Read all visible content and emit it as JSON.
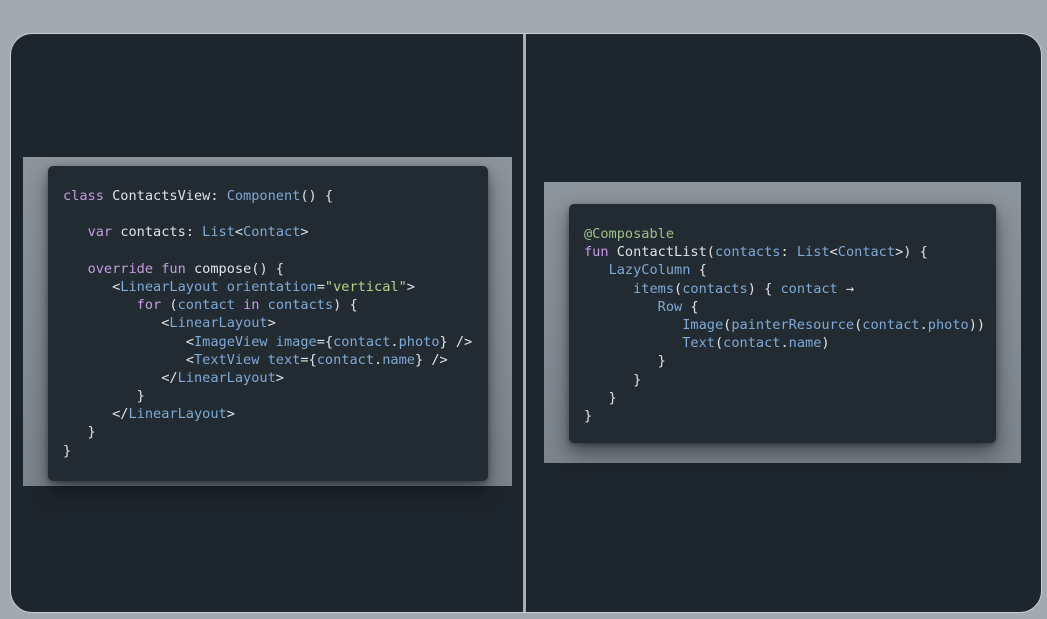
{
  "left_snippet": {
    "lines": [
      [
        {
          "c": "k",
          "t": "class "
        },
        {
          "c": "p",
          "t": "ContactsView: "
        },
        {
          "c": "t",
          "t": "Component"
        },
        {
          "c": "p",
          "t": "() {"
        }
      ],
      [],
      [
        {
          "c": "p",
          "t": "   "
        },
        {
          "c": "k",
          "t": "var "
        },
        {
          "c": "p",
          "t": "contacts: "
        },
        {
          "c": "t",
          "t": "List"
        },
        {
          "c": "p",
          "t": "<"
        },
        {
          "c": "t",
          "t": "Contact"
        },
        {
          "c": "p",
          "t": ">"
        }
      ],
      [],
      [
        {
          "c": "p",
          "t": "   "
        },
        {
          "c": "k",
          "t": "override fun "
        },
        {
          "c": "p",
          "t": "compose() {"
        }
      ],
      [
        {
          "c": "p",
          "t": "      <"
        },
        {
          "c": "t",
          "t": "LinearLayout orientation"
        },
        {
          "c": "p",
          "t": "="
        },
        {
          "c": "s",
          "t": "\"vertical\""
        },
        {
          "c": "p",
          "t": ">"
        }
      ],
      [
        {
          "c": "p",
          "t": "         "
        },
        {
          "c": "k",
          "t": "for "
        },
        {
          "c": "p",
          "t": "("
        },
        {
          "c": "t",
          "t": "contact "
        },
        {
          "c": "k",
          "t": "in "
        },
        {
          "c": "t",
          "t": "contacts"
        },
        {
          "c": "p",
          "t": ") {"
        }
      ],
      [
        {
          "c": "p",
          "t": "            <"
        },
        {
          "c": "t",
          "t": "LinearLayout"
        },
        {
          "c": "p",
          "t": ">"
        }
      ],
      [
        {
          "c": "p",
          "t": "               <"
        },
        {
          "c": "t",
          "t": "ImageView image"
        },
        {
          "c": "p",
          "t": "={"
        },
        {
          "c": "t",
          "t": "contact"
        },
        {
          "c": "p",
          "t": "."
        },
        {
          "c": "t",
          "t": "photo"
        },
        {
          "c": "p",
          "t": "} />"
        }
      ],
      [
        {
          "c": "p",
          "t": "               <"
        },
        {
          "c": "t",
          "t": "TextView text"
        },
        {
          "c": "p",
          "t": "={"
        },
        {
          "c": "t",
          "t": "contact"
        },
        {
          "c": "p",
          "t": "."
        },
        {
          "c": "t",
          "t": "name"
        },
        {
          "c": "p",
          "t": "} />"
        }
      ],
      [
        {
          "c": "p",
          "t": "            </"
        },
        {
          "c": "t",
          "t": "LinearLayout"
        },
        {
          "c": "p",
          "t": ">"
        }
      ],
      [
        {
          "c": "p",
          "t": "         }"
        }
      ],
      [
        {
          "c": "p",
          "t": "      </"
        },
        {
          "c": "t",
          "t": "LinearLayout"
        },
        {
          "c": "p",
          "t": ">"
        }
      ],
      [
        {
          "c": "p",
          "t": "   }"
        }
      ],
      [
        {
          "c": "p",
          "t": "}"
        }
      ]
    ]
  },
  "right_snippet": {
    "lines": [
      [
        {
          "c": "a",
          "t": "@Composable"
        }
      ],
      [
        {
          "c": "k",
          "t": "fun "
        },
        {
          "c": "p",
          "t": "ContactList("
        },
        {
          "c": "t",
          "t": "contacts"
        },
        {
          "c": "p",
          "t": ": "
        },
        {
          "c": "t",
          "t": "List"
        },
        {
          "c": "p",
          "t": "<"
        },
        {
          "c": "t",
          "t": "Contact"
        },
        {
          "c": "p",
          "t": ">) {"
        }
      ],
      [
        {
          "c": "p",
          "t": "   "
        },
        {
          "c": "t",
          "t": "LazyColumn"
        },
        {
          "c": "p",
          "t": " {"
        }
      ],
      [
        {
          "c": "p",
          "t": "      "
        },
        {
          "c": "t",
          "t": "items"
        },
        {
          "c": "p",
          "t": "("
        },
        {
          "c": "t",
          "t": "contacts"
        },
        {
          "c": "p",
          "t": ") { "
        },
        {
          "c": "t",
          "t": "contact"
        },
        {
          "c": "p",
          "t": " →"
        }
      ],
      [
        {
          "c": "p",
          "t": "         "
        },
        {
          "c": "t",
          "t": "Row"
        },
        {
          "c": "p",
          "t": " {"
        }
      ],
      [
        {
          "c": "p",
          "t": "            "
        },
        {
          "c": "t",
          "t": "Image"
        },
        {
          "c": "p",
          "t": "("
        },
        {
          "c": "t",
          "t": "painterResource"
        },
        {
          "c": "p",
          "t": "("
        },
        {
          "c": "t",
          "t": "contact"
        },
        {
          "c": "p",
          "t": "."
        },
        {
          "c": "t",
          "t": "photo"
        },
        {
          "c": "p",
          "t": "))"
        }
      ],
      [
        {
          "c": "p",
          "t": "            "
        },
        {
          "c": "t",
          "t": "Text"
        },
        {
          "c": "p",
          "t": "("
        },
        {
          "c": "t",
          "t": "contact"
        },
        {
          "c": "p",
          "t": "."
        },
        {
          "c": "t",
          "t": "name"
        },
        {
          "c": "p",
          "t": ")"
        }
      ],
      [
        {
          "c": "p",
          "t": "         }"
        }
      ],
      [
        {
          "c": "p",
          "t": "      }"
        }
      ],
      [
        {
          "c": "p",
          "t": "   }"
        }
      ],
      [
        {
          "c": "p",
          "t": "}"
        }
      ]
    ]
  }
}
